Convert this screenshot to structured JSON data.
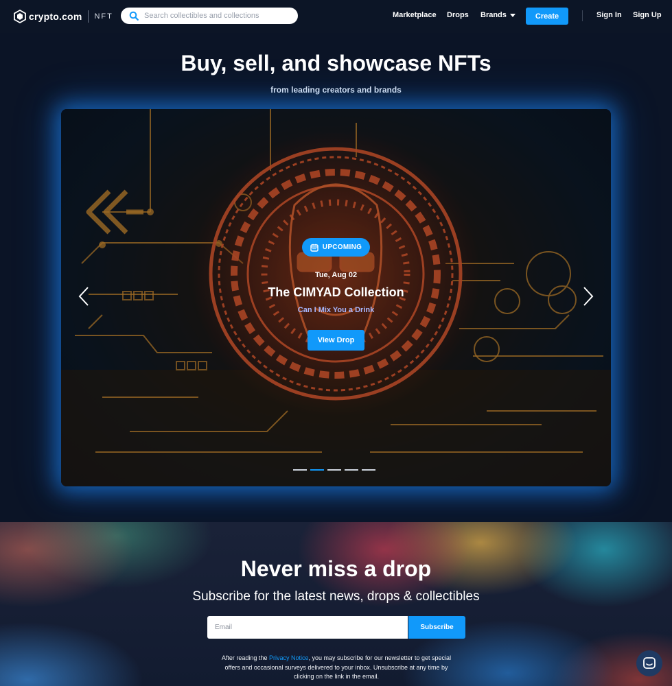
{
  "header": {
    "logo_text": "crypto.com",
    "logo_suffix": "NFT",
    "search_placeholder": "Search collectibles and collections",
    "nav": {
      "marketplace": "Marketplace",
      "drops": "Drops",
      "brands": "Brands",
      "create": "Create",
      "sign_in": "Sign In",
      "sign_up": "Sign Up"
    }
  },
  "hero": {
    "title": "Buy, sell, and showcase NFTs",
    "subtitle": "from leading creators and brands"
  },
  "banner": {
    "badge": "UPCOMING",
    "date": "Tue, Aug 02",
    "title": "The CIMYAD Collection",
    "subtitle": "Can I Mix You a Drink",
    "cta": "View Drop",
    "slides_total": 5,
    "active_slide": 2
  },
  "newsletter": {
    "title": "Never miss a drop",
    "subtitle": "Subscribe for the latest news, drops & collectibles",
    "email_placeholder": "Email",
    "button": "Subscribe",
    "legal_before": "After reading the ",
    "legal_link": "Privacy Notice",
    "legal_after": ", you may subscribe for our newsletter to get special offers and occasional surveys delivered to your inbox. Unsubscribe at any time by clicking on the link in the email."
  },
  "colors": {
    "accent": "#1199fa",
    "background": "#0b1426"
  },
  "icons": [
    "crypto-logo-icon",
    "search-icon",
    "chevron-down-icon",
    "calendar-icon",
    "arrow-left-icon",
    "arrow-right-icon",
    "chat-icon"
  ]
}
